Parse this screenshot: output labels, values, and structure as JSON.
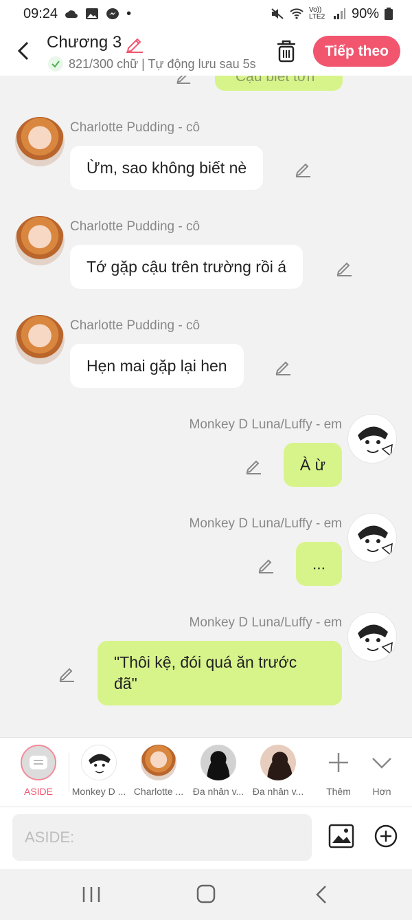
{
  "status_bar": {
    "time": "09:24",
    "dot": "•",
    "lte": "Vo)) LTE2",
    "battery": "90%"
  },
  "header": {
    "title": "Chương 3",
    "subtitle": "821/300 chữ | Tự động lưu sau 5s",
    "next_button": "Tiếp theo"
  },
  "chat": {
    "partial_message": "Cậu biết tớn",
    "messages": [
      {
        "sender": "Charlotte Pudding - cô",
        "text": "Ừm, sao không biết nè"
      },
      {
        "sender": "Charlotte Pudding - cô",
        "text": "Tớ gặp cậu trên trường rồi á"
      },
      {
        "sender": "Charlotte Pudding - cô",
        "text": "Hẹn mai gặp lại hen"
      },
      {
        "sender": "Monkey D Luna/Luffy - em",
        "text": "À ừ"
      },
      {
        "sender": "Monkey D Luna/Luffy - em",
        "text": "..."
      },
      {
        "sender": "Monkey D Luna/Luffy - em",
        "text_line1": "\"Thôi kệ, đói quá ăn trước",
        "text_line2": "đã\""
      }
    ]
  },
  "character_bar": {
    "aside": "ASIDE",
    "characters": [
      "Monkey D ...",
      "Charlotte ...",
      "Đa nhân v...",
      "Đa nhân v..."
    ],
    "add_label": "Thêm",
    "more_label": "Hơn"
  },
  "input": {
    "placeholder": "ASIDE:"
  },
  "colors": {
    "accent": "#f2566f",
    "bubble_green": "#d7f48b",
    "bubble_white": "#ffffff",
    "background": "#f2f2f2"
  }
}
